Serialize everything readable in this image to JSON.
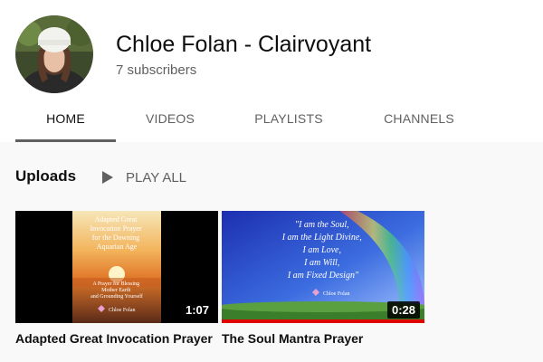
{
  "channel": {
    "name": "Chloe Folan - Clairvoyant",
    "subscribers": "7 subscribers"
  },
  "tabs": [
    {
      "label": "HOME",
      "active": true
    },
    {
      "label": "VIDEOS",
      "active": false
    },
    {
      "label": "PLAYLISTS",
      "active": false
    },
    {
      "label": "CHANNELS",
      "active": false
    }
  ],
  "uploads": {
    "title": "Uploads",
    "play_all": "PLAY ALL",
    "play_icon": "play-icon"
  },
  "videos": [
    {
      "title": "Adapted Great Invocation Prayer",
      "duration": "1:07",
      "watched_fraction": 0,
      "thumb_lines": [
        "Adapted Great",
        "Invocation Prayer",
        "for the Dawning",
        "Aquarian Age"
      ],
      "thumb_sub": [
        "A Prayer for Blessing",
        "Mother Earth",
        "and Grounding Yourself"
      ],
      "thumb_brand": "Chloe Folan"
    },
    {
      "title": "The Soul Mantra Prayer",
      "duration": "0:28",
      "watched_fraction": 1,
      "thumb_lines": [
        "\"I am the Soul,",
        "I am the Light Divine,",
        "I am Love,",
        "I am Will,",
        "I am Fixed Design\""
      ],
      "thumb_brand": "Chloe Folan"
    }
  ],
  "colors": {
    "accent_red": "#e00000",
    "tab_underline": "#606060",
    "background": "#f9f9f9"
  }
}
